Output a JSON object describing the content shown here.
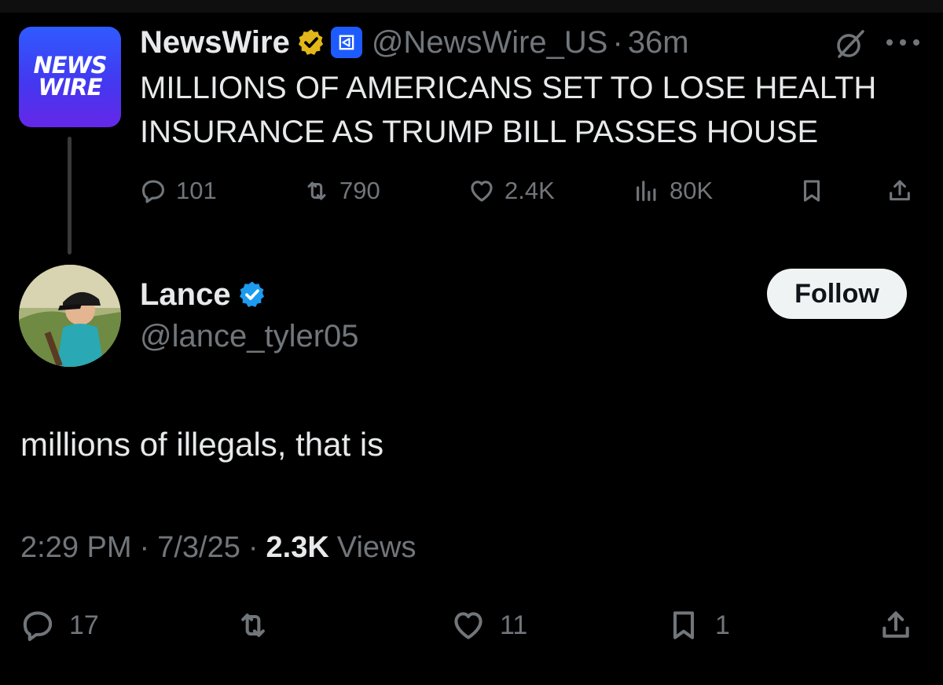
{
  "parent_tweet": {
    "avatar_text_line1": "NEWS",
    "avatar_text_line2": "WIRE",
    "display_name": "NewsWire",
    "handle": "@NewsWire_US",
    "separator": "·",
    "time_ago": "36m",
    "text": "MILLIONS OF AMERICANS SET TO LOSE HEALTH INSURANCE AS TRUMP BILL PASSES HOUSE",
    "actions": {
      "replies": "101",
      "reposts": "790",
      "likes": "2.4K",
      "views": "80K"
    },
    "icons": {
      "verified": "gold-verified-badge-icon",
      "affiliate": "affiliate-org-badge-icon",
      "grok": "grok-icon",
      "more": "more-icon"
    }
  },
  "main_tweet": {
    "display_name": "Lance",
    "handle": "@lance_tyler05",
    "follow_label": "Follow",
    "text": "millions of illegals, that is",
    "time": "2:29 PM",
    "separator": "·",
    "date": "7/3/25",
    "views_count": "2.3K",
    "views_label": "Views",
    "actions": {
      "replies": "17",
      "reposts": "",
      "likes": "11",
      "bookmarks": "1"
    }
  },
  "colors": {
    "background": "#000000",
    "text_primary": "#e7e9ea",
    "text_secondary": "#71767b",
    "verified_blue": "#1d9bf0",
    "verified_gold": "#e2b719",
    "follow_button_bg": "#eff3f4"
  }
}
